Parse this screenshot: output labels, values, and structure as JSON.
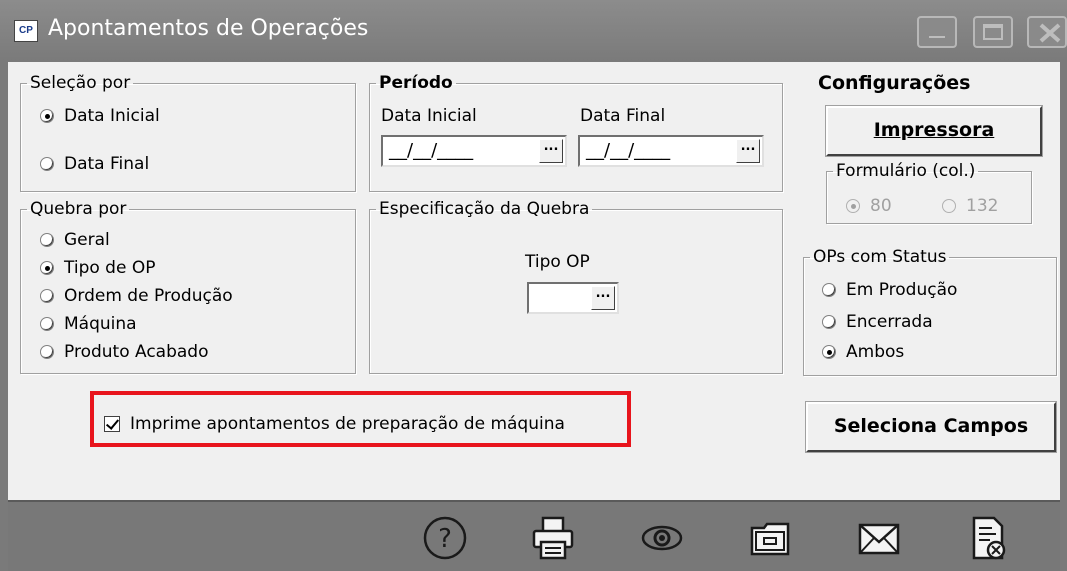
{
  "window": {
    "title": "Apontamentos de Operações",
    "icon_text": "CP",
    "controls": [
      "minimize-icon",
      "maximize-icon",
      "close-icon"
    ]
  },
  "selecao": {
    "legend": "Seleção por",
    "options": [
      {
        "label": "Data Inicial",
        "selected": true
      },
      {
        "label": "Data Final",
        "selected": false
      }
    ]
  },
  "periodo": {
    "legend": "Período",
    "data_inicial_label": "Data Inicial",
    "data_final_label": "Data Final",
    "data_inicial_value": "__/__/____",
    "data_final_value": "__/__/____",
    "ellipsis": "..."
  },
  "configuracoes": {
    "legend": "Configurações",
    "impressora_button": "Impressora",
    "formulario": {
      "legend": "Formulário (col.)",
      "options": [
        {
          "label": "80",
          "selected": true
        },
        {
          "label": "132",
          "selected": false
        }
      ]
    }
  },
  "quebra": {
    "legend": "Quebra por",
    "options": [
      {
        "label": "Geral",
        "selected": false
      },
      {
        "label": "Tipo de OP",
        "selected": true
      },
      {
        "label": "Ordem de Produção",
        "selected": false
      },
      {
        "label": "Máquina",
        "selected": false
      },
      {
        "label": "Produto Acabado",
        "selected": false
      }
    ]
  },
  "especificacao": {
    "legend": "Especificação da Quebra",
    "tipo_op_label": "Tipo OP",
    "tipo_op_value": "",
    "ellipsis": "..."
  },
  "status": {
    "legend": "OPs com Status",
    "options": [
      {
        "label": "Em Produção",
        "selected": false
      },
      {
        "label": "Encerrada",
        "selected": false
      },
      {
        "label": "Ambos",
        "selected": true
      }
    ]
  },
  "imprime_checkbox": {
    "label": "Imprime apontamentos de preparação de máquina",
    "checked": true
  },
  "seleciona_campos_button": "Seleciona Campos",
  "toolbar": {
    "icons": [
      "help-icon",
      "printer-icon",
      "preview-icon",
      "folder-icon",
      "email-icon",
      "cancel-document-icon"
    ],
    "help_glyph": "?"
  },
  "colors": {
    "highlight": "#e8141c",
    "titlebar": "#7a7a7a",
    "background": "#f0f0f0"
  }
}
